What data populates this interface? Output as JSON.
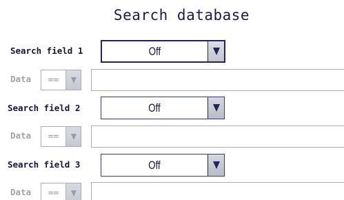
{
  "header": {
    "title": "Search database"
  },
  "rows": [
    {
      "field_label": "Search field 1",
      "field_value": "Off",
      "data_label": "Data",
      "operator": "==",
      "data_value": ""
    },
    {
      "field_label": "Search field 2",
      "field_value": "Off",
      "data_label": "Data",
      "operator": "==",
      "data_value": ""
    },
    {
      "field_label": "Search field 3",
      "field_value": "Off",
      "data_label": "Data",
      "operator": "==",
      "data_value": ""
    }
  ],
  "icons": {
    "dropdown": "triangle-down-icon"
  },
  "colors": {
    "text": "#14143f",
    "disabled_text": "#a3a3a8",
    "border": "#23235a"
  }
}
